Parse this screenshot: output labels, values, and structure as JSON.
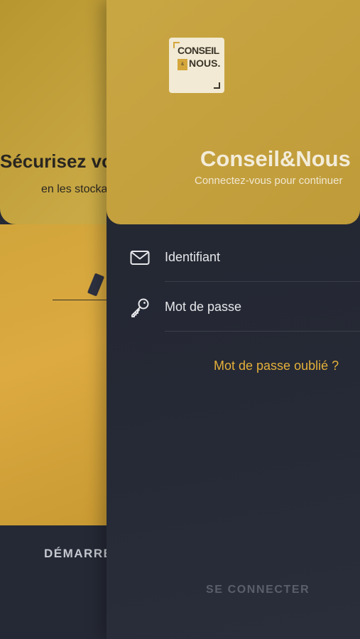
{
  "onboarding": {
    "headline": "Sécurisez vos",
    "subtitle": "en les stockant",
    "start_label": "DÉMARRER"
  },
  "logo": {
    "line1": "CONSEIL",
    "badge": "&",
    "line2": "NOUS."
  },
  "login": {
    "app_title": "Conseil&Nous",
    "subtitle": "Connectez-vous pour continuer",
    "identifier_placeholder": "Identifiant",
    "password_placeholder": "Mot de passe",
    "forgot_password": "Mot de passe oublié ?",
    "submit_label": "SE CONNECTER"
  },
  "colors": {
    "gold": "#c6a23f",
    "accent": "#e4b03a",
    "dark_bg": "#252935",
    "disabled_text": "#5a5f6b"
  },
  "icons": {
    "identifier": "mail-icon",
    "password": "key-icon"
  }
}
